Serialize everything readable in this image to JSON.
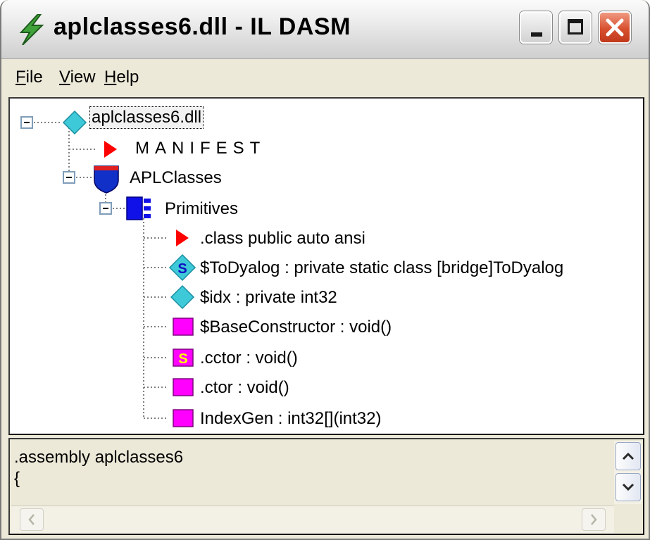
{
  "window": {
    "title": "aplclasses6.dll - IL DASM",
    "app_icon": "lightning-bolt-icon",
    "controls": {
      "minimize": "minimize-icon",
      "maximize": "maximize-icon",
      "close": "close-icon"
    },
    "close_color": "#d7502f"
  },
  "menu": {
    "file": "File",
    "view": "View",
    "help": "Help"
  },
  "tree": {
    "root": {
      "label": "aplclasses6.dll",
      "icon": "assembly-diamond-icon",
      "expanded": true
    },
    "manifest": {
      "label": "MANIFEST",
      "icon": "red-triangle-icon"
    },
    "namespace": {
      "label": "APLClasses",
      "icon": "namespace-shield-icon",
      "expanded": true
    },
    "class": {
      "label": "Primitives",
      "icon": "class-icon",
      "expanded": true
    },
    "members": [
      {
        "label": ".class public auto ansi",
        "icon": "red-triangle-icon"
      },
      {
        "label": "$ToDyalog : private static class [bridge]ToDyalog",
        "icon": "static-field-icon"
      },
      {
        "label": "$idx : private int32",
        "icon": "field-diamond-icon"
      },
      {
        "label": "$BaseConstructor : void()",
        "icon": "method-icon"
      },
      {
        "label": ".cctor : void()",
        "icon": "static-method-icon"
      },
      {
        "label": ".ctor : void()",
        "icon": "method-icon"
      },
      {
        "label": "IndexGen : int32[](int32)",
        "icon": "method-icon"
      }
    ]
  },
  "output": {
    "line1": ".assembly aplclasses6",
    "line2": "{"
  },
  "colors": {
    "tree_line": "#808080",
    "field": "#3ec9d9",
    "method": "#ff00ff",
    "manifest": "#ff0000",
    "class": "#0000ff"
  }
}
